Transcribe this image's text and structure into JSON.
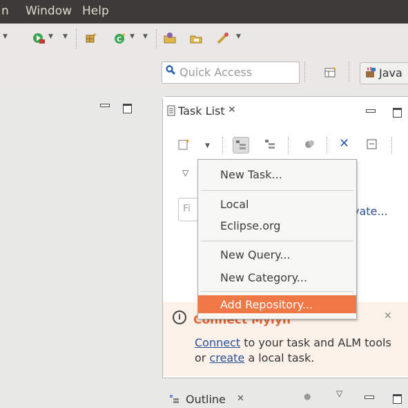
{
  "menubar": {
    "items": [
      "n",
      "Window",
      "Help"
    ]
  },
  "toolbar": {
    "icons": [
      "run-icon",
      "new-java-package-icon",
      "new-java-class-icon",
      "open-type-icon",
      "open-task-icon",
      "search-icon"
    ]
  },
  "quick_access": {
    "placeholder": "Quick Access"
  },
  "perspective": {
    "label": "Java"
  },
  "task_list": {
    "tab_label": "Task List",
    "find_placeholder": "Fi",
    "activate_link": "vate..."
  },
  "context_menu": {
    "items": [
      "New Task...",
      "Local",
      "Eclipse.org",
      "New Query...",
      "New Category...",
      "Add Repository..."
    ],
    "active": "Add Repository..."
  },
  "mylyn": {
    "title": "Connect Mylyn",
    "link_connect": "Connect",
    "text_1": " to your task and ALM tools or ",
    "link_create": "create",
    "text_2": " a local task."
  },
  "outline": {
    "tab_label": "Outline"
  },
  "colors": {
    "accent": "#f07746",
    "menubar_bg": "#3d3b37",
    "link": "#2a4f94"
  }
}
